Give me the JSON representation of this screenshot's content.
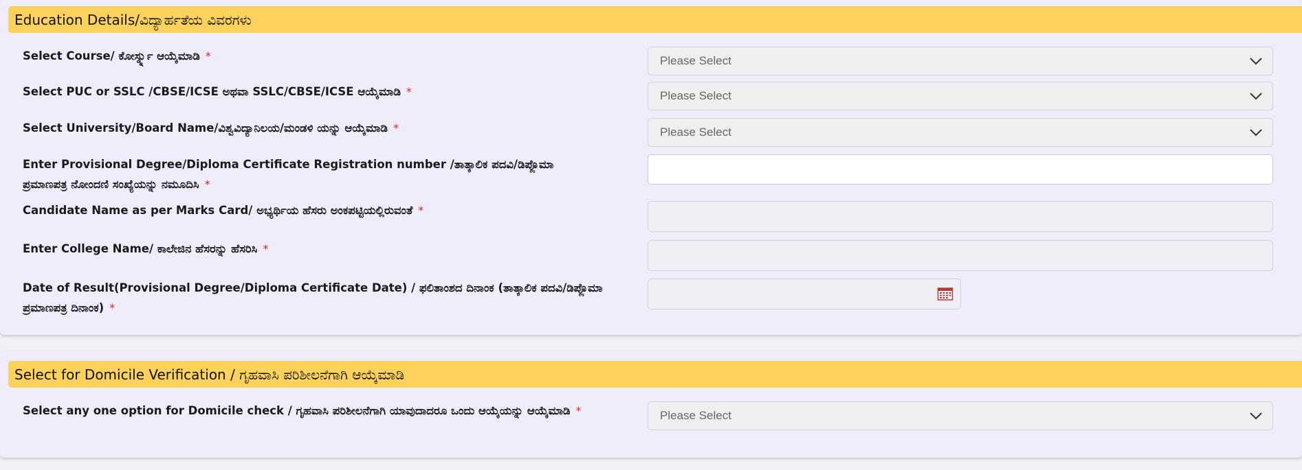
{
  "colors": {
    "header_bg": "#fcd15c",
    "card_bg": "#efedfc",
    "required_star": "#e2231a",
    "select_bg": "#efefef",
    "calendar_icon": "#b23a3a"
  },
  "icons": {
    "dropdown": "chevron-down-icon",
    "date_picker": "calendar-icon"
  },
  "education": {
    "title": "Education Details/ವಿದ್ಯಾರ್ಹತೆಯ ವಿವರಗಳು",
    "fields": [
      {
        "label": "Select Course/ ಕೋರ್ಸ್ನ್ನು ಆಯ್ಕೆಮಾಡಿ",
        "required": "*",
        "value": "Please Select"
      },
      {
        "label": "Select PUC or SSLC /CBSE/ICSE ಅಥವಾ SSLC/CBSE/ICSE ಆಯ್ಕೆಮಾಡಿ",
        "required": "*",
        "value": "Please Select"
      },
      {
        "label": "Select University/Board Name/ವಿಶ್ವವಿದ್ಯಾನಿಲಯ/ಮಂಡಳಿ ಯನ್ನು ಆಯ್ಕೆಮಾಡಿ",
        "required": "*",
        "value": "Please Select"
      },
      {
        "label": "Enter Provisional Degree/Diploma Certificate Registration number /ತಾತ್ಕಾಲಿಕ ಪದವಿ/ಡಿಪ್ಲೊಮಾ ಪ್ರಮಾಣಪತ್ರ ನೋಂದಣಿ ಸಂಖ್ಯೆಯನ್ನು ನಮೂದಿಸಿ",
        "required": "*",
        "value": ""
      },
      {
        "label": "Candidate Name as per Marks Card/ ಅಭ್ಯರ್ಥಿಯ ಹೆಸರು ಅಂಕಪಟ್ಟಿಯಲ್ಲಿರುವಂತೆ",
        "required": "*",
        "value": ""
      },
      {
        "label": "Enter College Name/ ಕಾಲೇಜಿನ ಹೆಸರನ್ನು ಹೆಸರಿಸಿ",
        "required": "*",
        "value": ""
      },
      {
        "label": "Date of Result(Provisional Degree/Diploma Certificate Date) / ಫಲಿತಾಂಶದ ದಿನಾಂಕ (ತಾತ್ಕಾಲಿಕ ಪದವಿ/ಡಿಪ್ಲೊಮಾ ಪ್ರಮಾಣಪತ್ರ ದಿನಾಂಕ)",
        "required": "*",
        "value": ""
      }
    ]
  },
  "domicile": {
    "title": "Select for Domicile Verification / ಗೃಹವಾಸಿ ಪರಿಶೀಲನೆಗಾಗಿ ಆಯ್ಕೆಮಾಡಿ",
    "field": {
      "label": "Select any one option for Domicile check / ಗೃಹವಾಸಿ ಪರಿಶೀಲನೆಗಾಗಿ ಯಾವುದಾದರೂ ಒಂದು ಆಯ್ಕೆಯನ್ನು ಆಯ್ಕೆಮಾಡಿ",
      "required": "*",
      "value": "Please Select"
    }
  }
}
